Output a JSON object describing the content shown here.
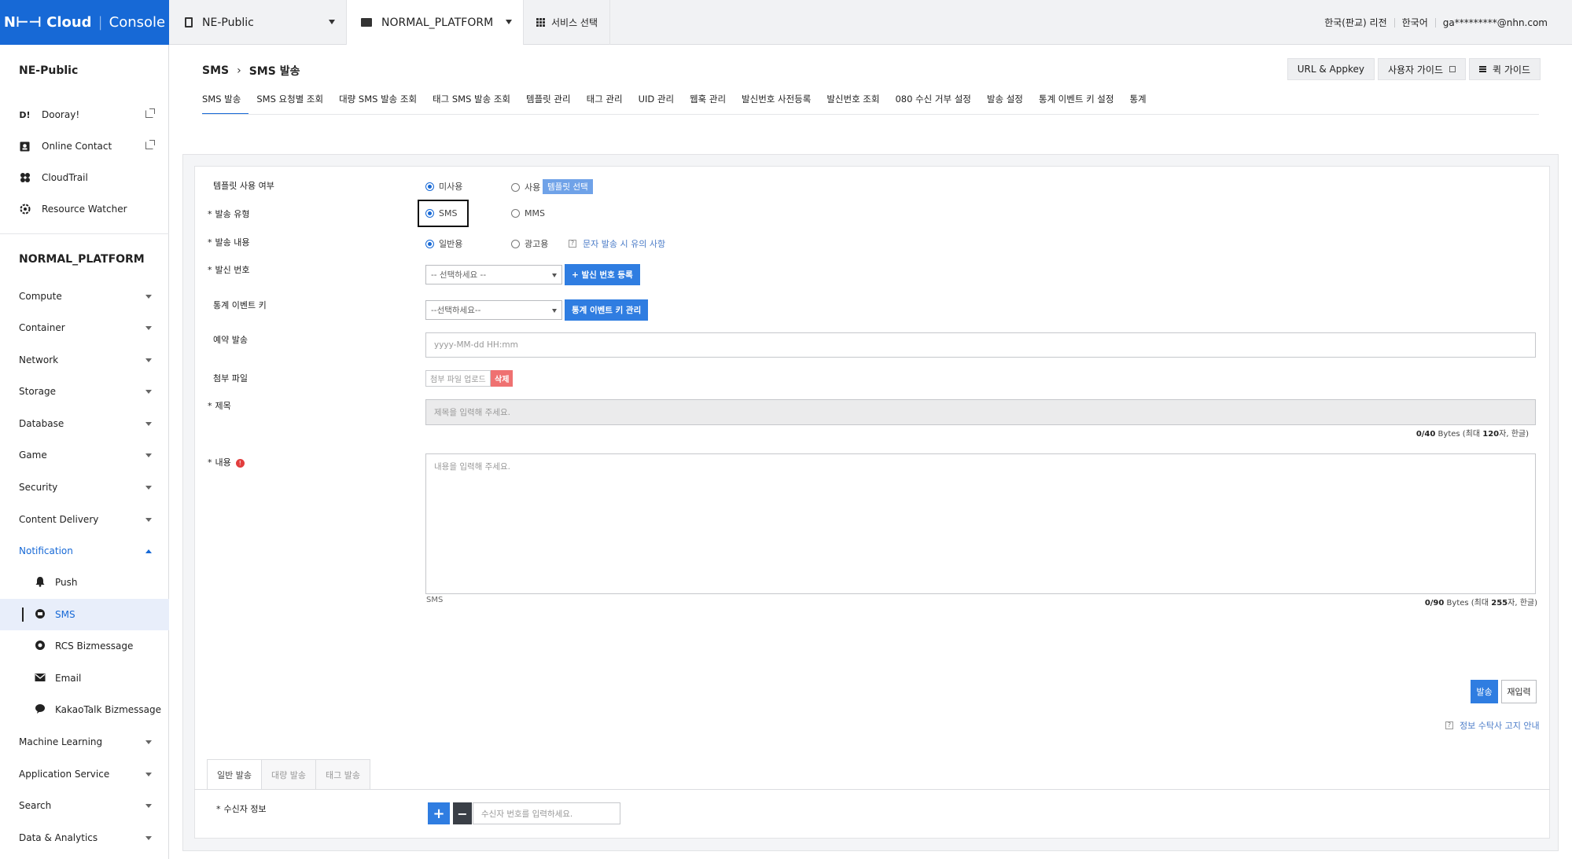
{
  "topbar": {
    "logo_brand": "N⊢⊣ Cloud",
    "logo_product": "Console",
    "org": "NE-Public",
    "project": "NORMAL_PLATFORM",
    "service_select": "서비스 선택",
    "region": "한국(판교) 리전",
    "language": "한국어",
    "user": "ga*********@nhn.com"
  },
  "sidebar": {
    "org_title": "NE-Public",
    "links": [
      {
        "label": "Dooray!",
        "icon": "dooray-icon"
      },
      {
        "label": "Online Contact",
        "icon": "online-contact-icon"
      },
      {
        "label": "CloudTrail",
        "icon": "cloudtrail-icon"
      },
      {
        "label": "Resource Watcher",
        "icon": "resource-watcher-icon"
      }
    ],
    "project_title": "NORMAL_PLATFORM",
    "categories": [
      "Compute",
      "Container",
      "Network",
      "Storage",
      "Database",
      "Game",
      "Security",
      "Content Delivery",
      "Notification"
    ],
    "notification_items": [
      {
        "label": "Push",
        "icon": "bell-icon"
      },
      {
        "label": "SMS",
        "icon": "sms-icon"
      },
      {
        "label": "RCS Bizmessage",
        "icon": "rcs-icon"
      },
      {
        "label": "Email",
        "icon": "mail-icon"
      },
      {
        "label": "KakaoTalk Bizmessage",
        "icon": "kakao-icon"
      }
    ],
    "bottom_categories": [
      "Machine Learning",
      "Application Service",
      "Search",
      "Data & Analytics"
    ]
  },
  "header": {
    "crumb_parent": "SMS",
    "crumb_current": "SMS 발송",
    "btn_url_appkey": "URL & Appkey",
    "btn_user_guide": "사용자 가이드",
    "btn_quick_guide": "퀵 가이드"
  },
  "tabs": [
    "SMS 발송",
    "SMS 요청별 조회",
    "대량 SMS 발송 조회",
    "태그 SMS 발송 조회",
    "템플릿 관리",
    "태그 관리",
    "UID 관리",
    "웹훅 관리",
    "발신번호 사전등록",
    "발신번호 조회",
    "080 수신 거부 설정",
    "발송 설정",
    "통계 이벤트 키 설정",
    "통계"
  ],
  "form": {
    "template_use_label": "템플릿 사용 여부",
    "template_unused": "미사용",
    "template_used": "사용",
    "template_select_btn": "템플릿 선택",
    "send_type_label": "발송 유형",
    "send_type_sms": "SMS",
    "send_type_mms": "MMS",
    "content_type_label": "발송 내용",
    "content_type_normal": "일반용",
    "content_type_ad": "광고용",
    "notice_link": "문자 발송 시 유의 사항",
    "sender_label": "발신 번호",
    "sender_placeholder": "-- 선택하세요 --",
    "sender_register_btn": "+ 발신 번호 등록",
    "stat_key_label": "통계 이벤트 키",
    "stat_key_placeholder": "--선택하세요--",
    "stat_key_manage_btn": "통계 이벤트 키 관리",
    "reserve_label": "예약 발송",
    "reserve_placeholder": "yyyy-MM-dd HH:mm",
    "attach_label": "첨부 파일",
    "attach_upload": "첨부 파일 업로드",
    "attach_delete": "삭제",
    "title_label": "제목",
    "title_placeholder": "제목을 입력해 주세요.",
    "title_bytes_used": "0",
    "title_bytes_max": "/40",
    "title_bytes_unit": " Bytes (최대 ",
    "title_bytes_chars": "120",
    "title_bytes_suffix": "자, 한글)",
    "body_label": "내용",
    "body_placeholder": "내용을 입력해 주세요.",
    "body_type": "SMS",
    "body_bytes_used": "0",
    "body_bytes_max": "/90",
    "body_bytes_unit": " Bytes (최대 ",
    "body_bytes_chars": "255",
    "body_bytes_suffix": "자, 한글)",
    "send_btn": "발송",
    "reset_btn": "재입력",
    "privacy_link": "정보 수탁사 고지 안내"
  },
  "recipient": {
    "tabs": [
      "일반 발송",
      "대량 발송",
      "태그 발송"
    ],
    "label": "수신자 정보",
    "plus": "+",
    "minus": "−",
    "placeholder": "수신자 번호를 입력하세요."
  },
  "colors": {
    "brand": "#1769d6",
    "accent_button": "#2f7de1",
    "delete_button": "#ef7171"
  }
}
